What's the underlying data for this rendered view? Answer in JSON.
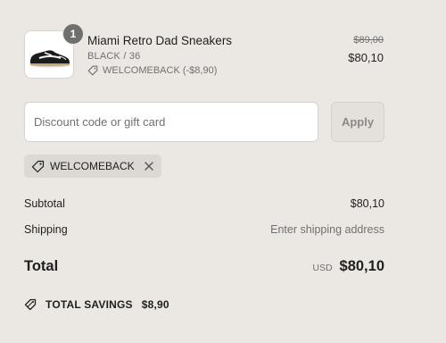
{
  "product": {
    "quantity": "1",
    "name": "Miami Retro Dad Sneakers",
    "variant": "BLACK / 36",
    "discount_line": "WELCOMEBACK (-$8,90)",
    "original_price": "$89,00",
    "price": "$80,10",
    "image_icon": "sneaker-image"
  },
  "discount": {
    "placeholder": "Discount code or gift card",
    "value": "",
    "apply_label": "Apply",
    "applied_code": "WELCOMEBACK"
  },
  "summary": {
    "subtotal_label": "Subtotal",
    "subtotal_value": "$80,10",
    "shipping_label": "Shipping",
    "shipping_value": "Enter shipping address",
    "total_label": "Total",
    "currency": "USD",
    "total_value": "$80,10"
  },
  "savings": {
    "label": "TOTAL SAVINGS",
    "amount": "$8,90"
  },
  "colors": {
    "background": "#ebe8e3",
    "text": "#1f1f1f",
    "muted": "#707070",
    "badge": "#6f6f6f"
  }
}
